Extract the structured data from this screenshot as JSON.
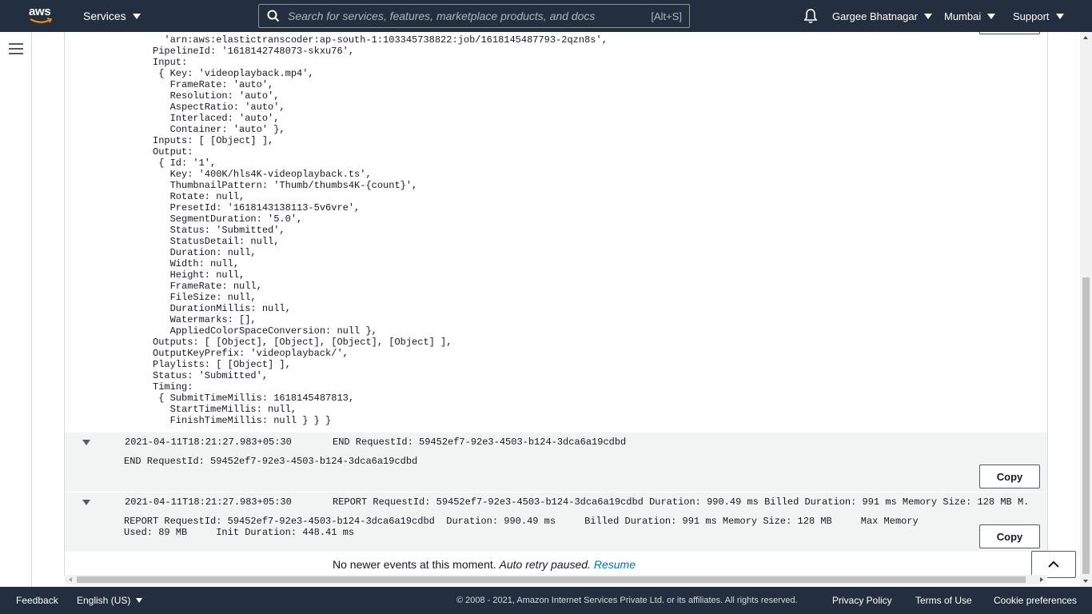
{
  "header": {
    "logo_text": "aws",
    "services_label": "Services",
    "search_placeholder": "Search for services, features, marketplace products, and docs",
    "search_shortcut": "[Alt+S]",
    "user_label": "Gargee Bhatnagar",
    "region_label": "Mumbai",
    "support_label": "Support"
  },
  "log": {
    "code_block": "  'arn:aws:elastictranscoder:ap-south-1:103345738822:job/1618145487793-2qzn8s',\nPipelineId: '1618142748073-skxu76',\nInput:\n { Key: 'videoplayback.mp4',\n   FrameRate: 'auto',\n   Resolution: 'auto',\n   AspectRatio: 'auto',\n   Interlaced: 'auto',\n   Container: 'auto' },\nInputs: [ [Object] ],\nOutput:\n { Id: '1',\n   Key: '400K/hls4K-videoplayback.ts',\n   ThumbnailPattern: 'Thumb/thumbs4K-{count}',\n   Rotate: null,\n   PresetId: '1618143138113-5v6vre',\n   SegmentDuration: '5.0',\n   Status: 'Submitted',\n   StatusDetail: null,\n   Duration: null,\n   Width: null,\n   Height: null,\n   FrameRate: null,\n   FileSize: null,\n   DurationMillis: null,\n   Watermarks: [],\n   AppliedColorSpaceConversion: null },\nOutputs: [ [Object], [Object], [Object], [Object] ],\nOutputKeyPrefix: 'videoplayback/',\nPlaylists: [ [Object] ],\nStatus: 'Submitted',\nTiming:\n { SubmitTimeMillis: 1618145487813,\n   StartTimeMillis: null,\n   FinishTimeMillis: null } } }",
    "events": [
      {
        "timestamp": "2021-04-11T18:21:27.983+05:30",
        "message": "END RequestId: 59452ef7-92e3-4503-b124-3dca6a19cdbd",
        "detail": "END RequestId: 59452ef7-92e3-4503-b124-3dca6a19cdbd",
        "copy_label": "Copy"
      },
      {
        "timestamp": "2021-04-11T18:21:27.983+05:30",
        "message": "REPORT RequestId: 59452ef7-92e3-4503-b124-3dca6a19cdbd Duration: 990.49 ms Billed Duration: 991 ms Memory Size: 128 MB M...",
        "detail": "REPORT RequestId: 59452ef7-92e3-4503-b124-3dca6a19cdbd  Duration: 990.49 ms     Billed Duration: 991 ms Memory Size: 128 MB     Max Memory\nUsed: 89 MB     Init Duration: 448.41 ms",
        "copy_label": "Copy"
      }
    ],
    "status_text": "No newer events at this moment. ",
    "status_italic": "Auto retry paused.",
    "resume_label": "Resume"
  },
  "footer": {
    "feedback": "Feedback",
    "language": "English (US)",
    "copyright": "© 2008 - 2021, Amazon Internet Services Private Ltd. or its affiliates. All rights reserved.",
    "privacy": "Privacy Policy",
    "terms": "Terms of Use",
    "cookies": "Cookie preferences"
  },
  "icons": {
    "menu": "hamburger-menu-icon",
    "search": "search-icon",
    "notifications": "bell-icon",
    "expand": "triangle-down-icon",
    "scroll_top": "chevron-up-icon"
  },
  "colors": {
    "nav_bg": "#232f3e",
    "link": "#0073bb",
    "event_row_bg": "#f2f3f3"
  }
}
